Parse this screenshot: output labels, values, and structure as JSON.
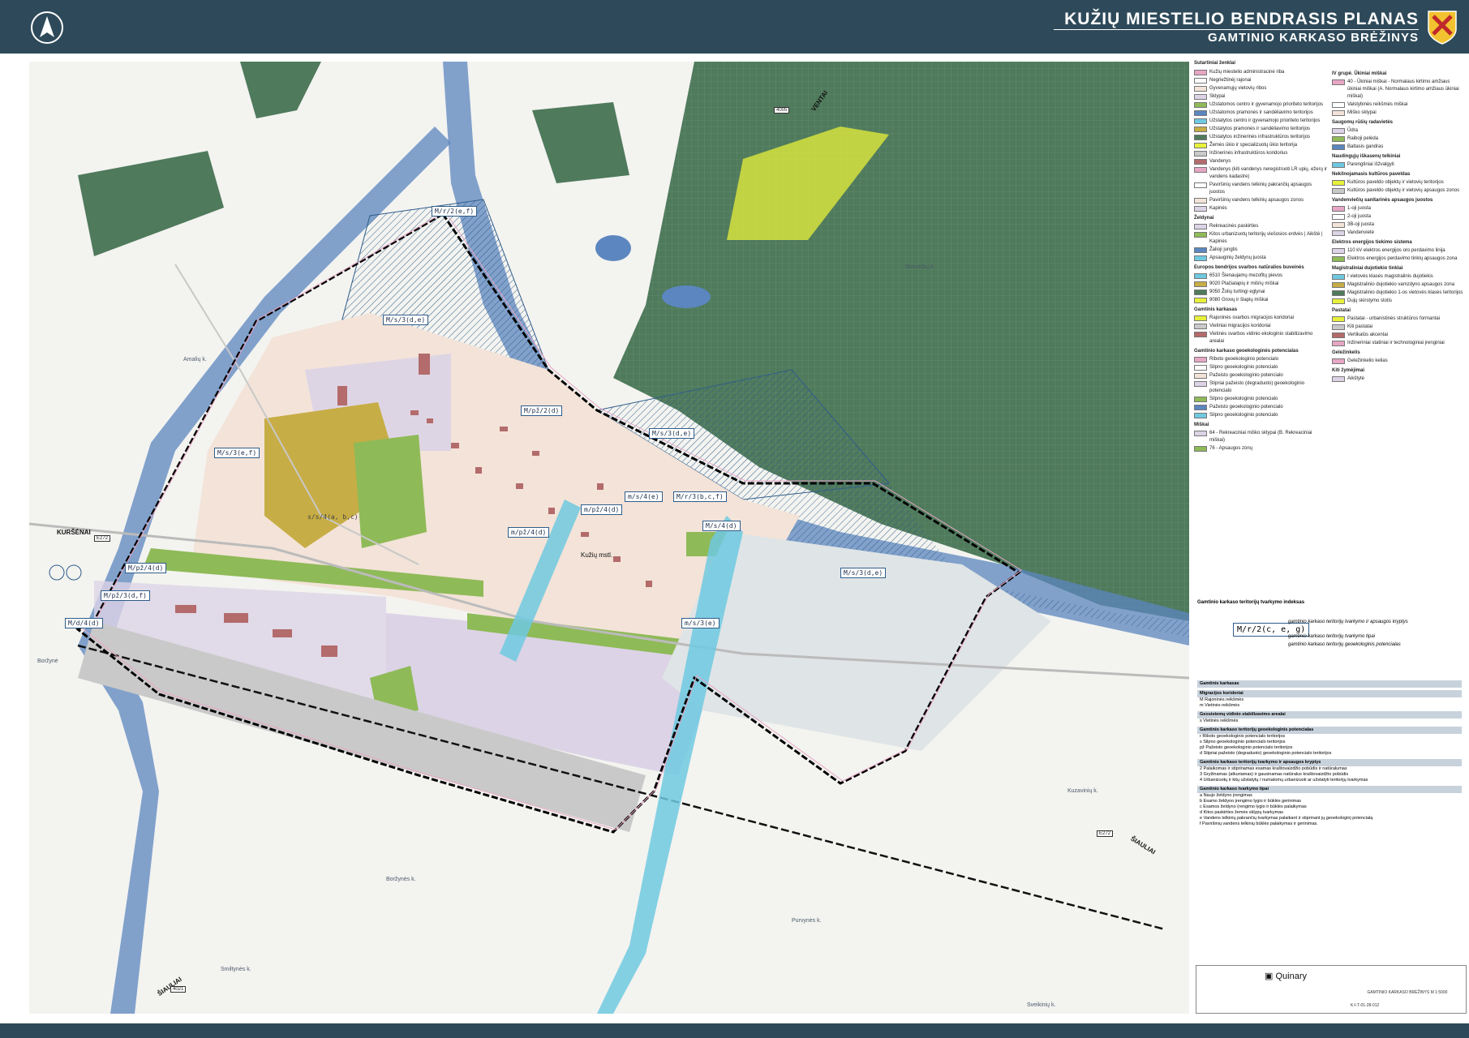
{
  "header": {
    "title": "KUŽIŲ MIESTELIO BENDRASIS PLANAS",
    "subtitle": "GAMTINIO KARKASO BRĖŽINYS"
  },
  "colors": {
    "header_bg": "#2e4a5a",
    "forest": "#4f7a5c",
    "water_corridor": "#5b86bf",
    "residential": "#f3e3d8",
    "industrial": "#dcd3e6",
    "green_space": "#8fba58",
    "boundary": "#000000"
  },
  "map": {
    "zone_labels": [
      "M/r/2(e,f)",
      "M/s/3(d,e)",
      "M/s/3(e,f)",
      "M/pž/2(d)",
      "M/s/3(d,e)",
      "M/r/3(b,c,f)",
      "m/s/4(e)",
      "m/pž/4(d)",
      "m/pž/4(d)",
      "M/s/4(d)",
      "M/s/3(d,e)",
      "M/pž/4(d)",
      "M/pž/3(d,f)",
      "M/d/4(d)",
      "m/s/3(e)",
      "s/s/4(a, b,c)"
    ],
    "places": [
      "Amalių k.",
      "Kužių mstl.",
      "Norvaišių k.",
      "Kuzavinių k.",
      "Boržynės k.",
      "Purvynės k.",
      "Smiltynės k.",
      "Sveikinių k.",
      "Boržynė"
    ],
    "directions": [
      "KURŠĖNAI",
      "VENTAI",
      "ŠIAULIAI",
      "ŠIAULIAI"
    ],
    "road_signs": [
      "4005",
      "E272",
      "E272",
      "4021"
    ]
  },
  "legend": {
    "title": "Sutartiniai ženklai",
    "col1": [
      {
        "h": "",
        "items": [
          "Kužių miestelio administracinė riba",
          "Negriežtinėj rajonai",
          "Gyvenamųjų vietovių ribos",
          "Sklypai",
          "Užstatomos centro ir gyvenamojo prioriteto teritorijos",
          "Užstatomos pramonės ir sandėliavimo teritorijos",
          "Užstatytos centro ir gyvenamojo prioriteto teritorijos",
          "Užstatytos pramonės ir sandėliavimo teritorijos",
          "Užstatytos inžinerinės infrastruktūros teritorijos",
          "Žemės ūkio ir specializuotų ūkio teritorija",
          "Inžinerinės infrastruktūros koridorius",
          "Vandenys",
          "Vandenys (kiti vandenys neregistruoti LR upių, ežerų ir vandens kadastre)",
          "Paviršinių vandens telkinių pakrančių apsaugos juostos",
          "Paviršinių vandens telkinių apsaugos zonos",
          "Kapinės"
        ]
      },
      {
        "h": "Želdynai",
        "items": [
          "Rekreacinės paskirties",
          "Kitos urbanizuotų teritorijų viešosios erdvės | Aikštė | Kapinės",
          "Žalioji jungtis",
          "Apsauginių želdynų juosta"
        ]
      },
      {
        "h": "Europos bendrijos svarbos natūralios buveinės",
        "items": [
          "6510 Šienaujamų mezofitų pievos",
          "9020 Plačialapių ir mišrių miškai",
          "9050 Žolių turtingi eglynai",
          "9080 Grovų ir šlapių miškai"
        ]
      },
      {
        "h": "Gamtinis karkasas",
        "items": [
          "Rajoninės svarbos migracijos koridoriai",
          "Vietiniai migracijos koridoriai",
          "Vietinės svarbos vidinio ekologinio stabilizavimo arealai"
        ]
      },
      {
        "h": "Gamtinio karkaso geoekologinės potencialas",
        "items": [
          "Riboto geoekologinio potencialo",
          "Silpno geoekologinio potencialo",
          "Pažeisto geoekologinio potencialo",
          "Stipriai pažeisto (degraduoto) geoekologinio potencialo",
          "Silpno geoekologinio potencialo",
          "Pažeisto geoekologinio potencialo",
          "Silpno geoekologinio potencialo"
        ]
      },
      {
        "h": "Miškai",
        "items": [
          "64 - Rekreaciniai miško sklypai (B. Rekreaciniai miškai)",
          "76 - Apsaugos zonų"
        ]
      }
    ],
    "col2": [
      {
        "h": "IV grupė. Ūkiniai miškai",
        "items": [
          "40 - Ūkiniai miškai - Normalaus kirtimo amžiaus ūkiniai miškai (A. Normalaus kirtimo amžiaus ūkiniai miškai)",
          "Valstybinės reikšmės miškai",
          "Miško sklypai"
        ]
      },
      {
        "h": "Saugomų rūšių radavietės",
        "items": [
          "Ūdra",
          "Raiboji pelėda",
          "Baltasis gandras"
        ]
      },
      {
        "h": "Naudingųjų iškasenų telkiniai",
        "items": [
          "Parengtiniai išžvalgyti"
        ]
      },
      {
        "h": "Nekilnojamasis kultūros paveldas",
        "items": [
          "Kultūros paveldo objektų ir vietovių teritorijos",
          "Kultūros paveldo objektų ir vietovių apsaugos zonos"
        ]
      },
      {
        "h": "Vandenviečių sanitarinės apsaugos juostos",
        "items": [
          "1-oji juosta",
          "2-oji juosta",
          "3B-oji juosta",
          "Vandenvietė"
        ]
      },
      {
        "h": "Elektros energijos tiekimo sistema",
        "items": [
          "110 kV elektros energijos oro perdavimo linija",
          "Elektros energijos perdavimo tinklų apsaugos zona"
        ]
      },
      {
        "h": "Magistraliniai dujotiekio tinklai",
        "items": [
          "I vietovės klasės magistralinis dujotiekis",
          "Magistralinio dujotiekio vamzdyno apsaugos zona",
          "Magistralinio dujotiekio 1-os vietovės klasės teritorijos",
          "Dujų skirstymo stotis"
        ]
      },
      {
        "h": "Pastatai",
        "items": [
          "Pastatai - urbanistinės struktūros formantai",
          "Kiti pastatai",
          "Vertikalūs akcentai",
          "Inžineriniai statiniai ir technologiniai įrenginiai"
        ]
      },
      {
        "h": "Geležinkelis",
        "items": [
          "Geležinkelio kelias"
        ]
      },
      {
        "h": "Kiti žymėjimai",
        "items": [
          "Aikštytė"
        ]
      }
    ]
  },
  "index": {
    "title": "Gamtinio karkaso teritorijų tvarkymo indeksas",
    "example": "M/r/2(c, e, g)",
    "lines": [
      "gamtinio karkaso teritorijų tvarkymo ir apsaugos kryptys",
      "gamtinio karkaso teritorijų tvarkymo tipai",
      "gamtinio karkaso teritorijų geoekologinis potencialas"
    ]
  },
  "tables": [
    {
      "h": "Gamtinis karkasas",
      "rows": []
    },
    {
      "h": "Migracijos koridoriai",
      "rows": [
        "M   Rajoninės reikšmės",
        "m   Vietinės reikšmės"
      ]
    },
    {
      "h": "Geosistemų vidinio stabilizavimo arealai",
      "rows": [
        "s   Vietinės reikšmės"
      ]
    },
    {
      "h": "Gamtinio karkaso teritorijų geoekologinis potencialas",
      "rows": [
        "r   Riboto geoekologinio potencialo teritorijos",
        "s   Silpno geoekologinio potencialo teritorijos",
        "pž  Pažeisto geoekologinio potencialo teritorijos",
        "d   Stipriai pažeisto (degraduoto) geoekologinio potencialo teritorijos"
      ]
    },
    {
      "h": "Gamtinio karkaso teritorijų tvarkymo ir apsaugos kryptys",
      "rows": [
        "2   Palaikomas ir stiprinamas esamas kraštovaizdžio pobūdis ir natūralumas",
        "3   Gryžinamas (atkuriamas) ir gausinamas natūralus kraštovaizdžio pobūdis",
        "4   Urbanizuotų ir kitų užstatytų / numatomų urbanizuoti ar užstatyti teritorijų tvarkymas"
      ]
    },
    {
      "h": "Gamtinio karkaso tvarkymo tipai",
      "rows": [
        "a   Naujo želdyno įrengimas",
        "b   Esamo želdyno įrengimo lygio ir būklės gerinimas",
        "c   Esamos želdyno (rengimo lygio ir būklės palaikymas",
        "d   Kitos paskirties žemės sklypų tvarkymas",
        "e   Vandens telkinių pakrančių tvarkymas palaikant ir stiprinant jų geoekologinį potencialą",
        "f   Paviršinių vandens telkinių būklės palaikymas ir gerinimas."
      ]
    }
  ],
  "stamp": {
    "company": "Quinary",
    "drawing": "GAMTINIO KARKASO BRĖŽINYS M 1:5000",
    "code": "K-I-T-01-28-012"
  }
}
